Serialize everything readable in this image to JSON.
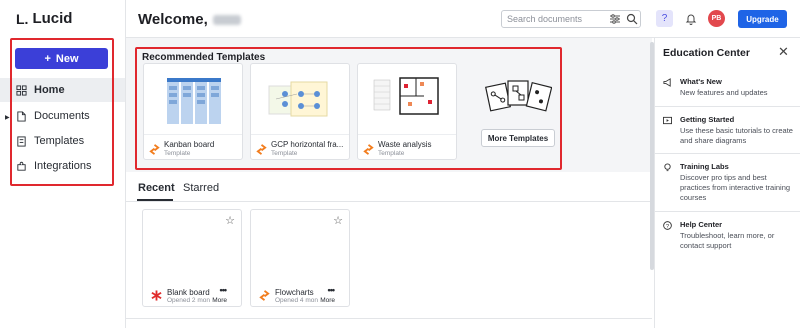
{
  "brand": {
    "name": "Lucid"
  },
  "sidebar": {
    "new_label": "New",
    "items": [
      {
        "label": "Home",
        "icon": "grid-icon"
      },
      {
        "label": "Documents",
        "icon": "document-icon"
      },
      {
        "label": "Templates",
        "icon": "templates-icon"
      },
      {
        "label": "Integrations",
        "icon": "puzzle-icon"
      }
    ]
  },
  "header": {
    "welcome": "Welcome,",
    "search_placeholder": "Search documents",
    "user_initials": "PB",
    "upgrade_label": "Upgrade"
  },
  "templates": {
    "heading": "Recommended Templates",
    "cards": [
      {
        "name": "Kanban board",
        "sub": "Template"
      },
      {
        "name": "GCP horizontal fra...",
        "sub": "Template"
      },
      {
        "name": "Waste analysis",
        "sub": "Template"
      }
    ],
    "more_label": "More Templates"
  },
  "tabs": [
    "Recent",
    "Starred"
  ],
  "recent": [
    {
      "name": "Blank board",
      "opened": "Opened 2 mon",
      "more": "More"
    },
    {
      "name": "Flowcharts",
      "opened": "Opened 4 mon",
      "more": "More"
    }
  ],
  "education": {
    "title": "Education Center",
    "items": [
      {
        "title": "What's New",
        "desc": "New features and updates"
      },
      {
        "title": "Getting Started",
        "desc": "Use these basic tutorials to create and share diagrams"
      },
      {
        "title": "Training Labs",
        "desc": "Discover pro tips and best practices from interactive training courses"
      },
      {
        "title": "Help Center",
        "desc": "Troubleshoot, learn more, or contact support"
      }
    ]
  },
  "colors": {
    "accent": "#3b3fd8",
    "upgrade": "#1f64e6",
    "highlight": "#e0282e",
    "avatar": "#e2484d"
  }
}
